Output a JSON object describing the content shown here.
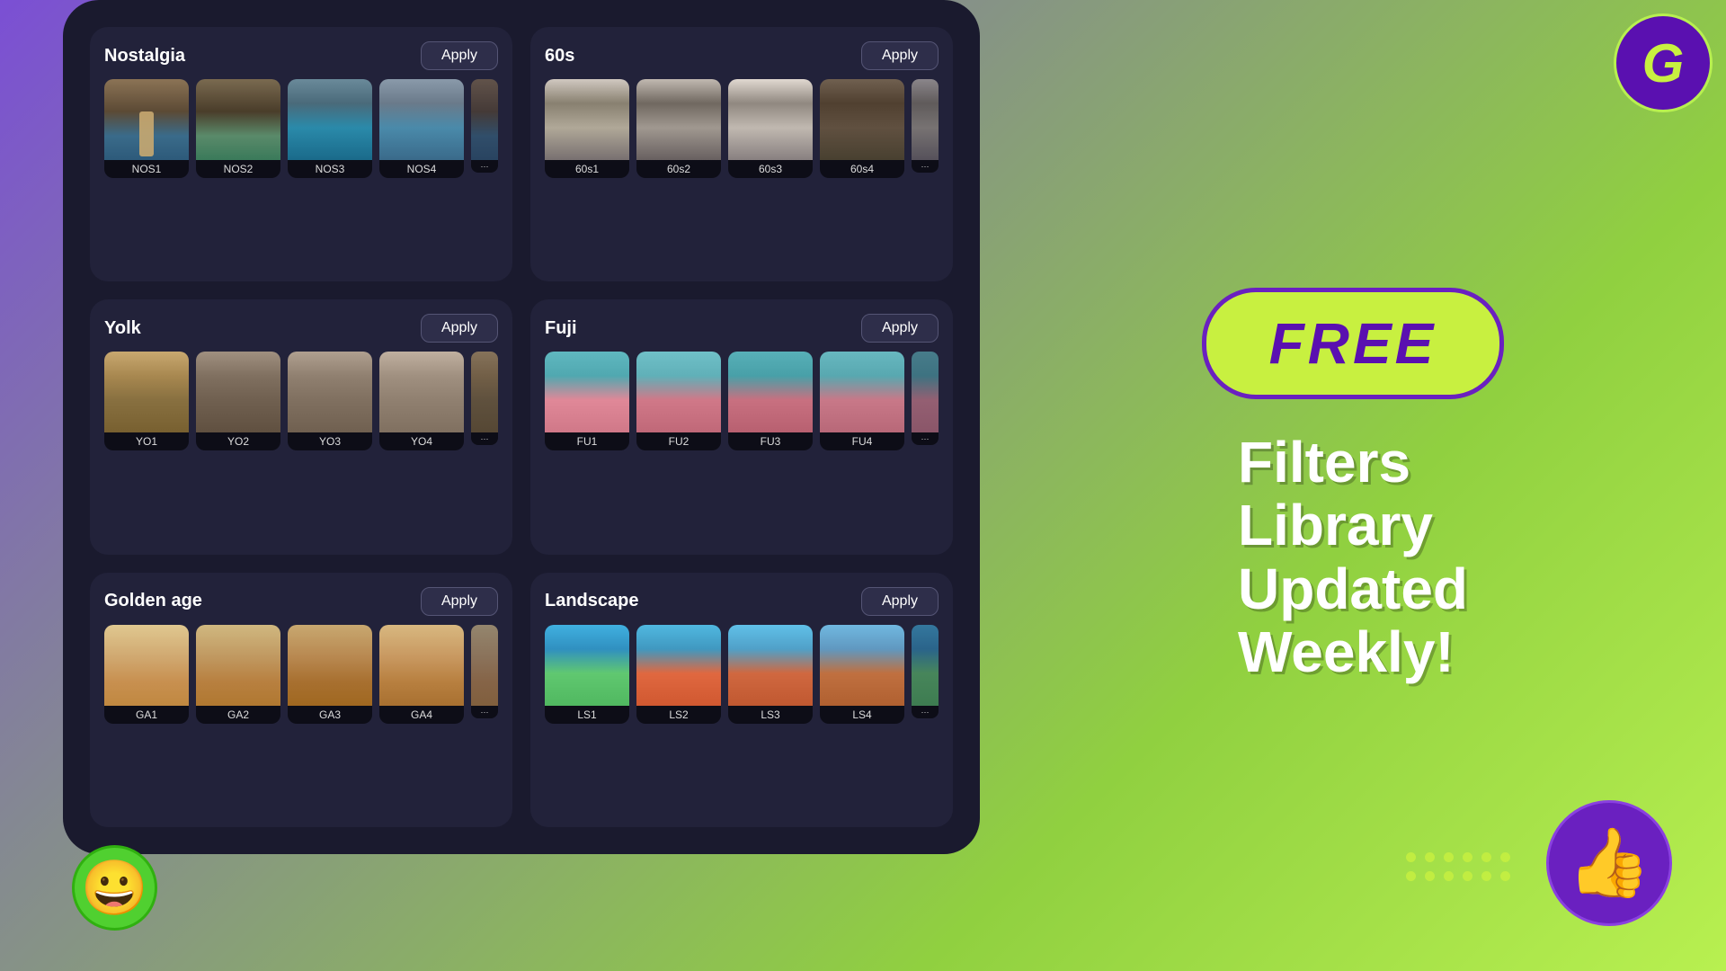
{
  "background": {
    "gradient_start": "#7b4fd4",
    "gradient_end": "#b8f050"
  },
  "filters": [
    {
      "id": "nostalgia",
      "title": "Nostalgia",
      "apply_label": "Apply",
      "thumbnails": [
        {
          "id": "NOS1",
          "label": "NOS1",
          "class": "nos1"
        },
        {
          "id": "NOS2",
          "label": "NOS2",
          "class": "nos2"
        },
        {
          "id": "NOS3",
          "label": "NOS3",
          "class": "nos3"
        },
        {
          "id": "NOS4",
          "label": "NOS4",
          "class": "nos4"
        }
      ]
    },
    {
      "id": "60s",
      "title": "60s",
      "apply_label": "Apply",
      "thumbnails": [
        {
          "id": "60s1",
          "label": "60s1",
          "class": "s60_1"
        },
        {
          "id": "60s2",
          "label": "60s2",
          "class": "s60_2"
        },
        {
          "id": "60s3",
          "label": "60s3",
          "class": "s60_3"
        },
        {
          "id": "60s4",
          "label": "60s4",
          "class": "s60_4"
        }
      ]
    },
    {
      "id": "yolk",
      "title": "Yolk",
      "apply_label": "Apply",
      "thumbnails": [
        {
          "id": "YO1",
          "label": "YO1",
          "class": "yo1"
        },
        {
          "id": "YO2",
          "label": "YO2",
          "class": "yo2"
        },
        {
          "id": "YO3",
          "label": "YO3",
          "class": "yo3"
        },
        {
          "id": "YO4",
          "label": "YO4",
          "class": "yo4"
        }
      ]
    },
    {
      "id": "fuji",
      "title": "Fuji",
      "apply_label": "Apply",
      "thumbnails": [
        {
          "id": "FU1",
          "label": "FU1",
          "class": "fu1"
        },
        {
          "id": "FU2",
          "label": "FU2",
          "class": "fu2"
        },
        {
          "id": "FU3",
          "label": "FU3",
          "class": "fu3"
        },
        {
          "id": "FU4",
          "label": "FU4",
          "class": "fu4"
        }
      ]
    },
    {
      "id": "golden-age",
      "title": "Golden age",
      "apply_label": "Apply",
      "thumbnails": [
        {
          "id": "GA1",
          "label": "GA1",
          "class": "ga1"
        },
        {
          "id": "GA2",
          "label": "GA2",
          "class": "ga2"
        },
        {
          "id": "GA3",
          "label": "GA3",
          "class": "ga3"
        },
        {
          "id": "GA4",
          "label": "GA4",
          "class": "ga4"
        }
      ]
    },
    {
      "id": "landscape",
      "title": "Landscape",
      "apply_label": "Apply",
      "thumbnails": [
        {
          "id": "LS1",
          "label": "LS1",
          "class": "ls1"
        },
        {
          "id": "LS2",
          "label": "LS2",
          "class": "ls2"
        },
        {
          "id": "LS3",
          "label": "LS3",
          "class": "ls3"
        },
        {
          "id": "LS4",
          "label": "LS4",
          "class": "ls4"
        }
      ]
    }
  ],
  "promo": {
    "free_label": "FREE",
    "tagline_line1": "Filters",
    "tagline_line2": "Library",
    "tagline_line3": "Updated",
    "tagline_line4": "Weekly!"
  },
  "icons": {
    "logo": "G",
    "thumbs_up": "👍",
    "smiley": "😀"
  }
}
